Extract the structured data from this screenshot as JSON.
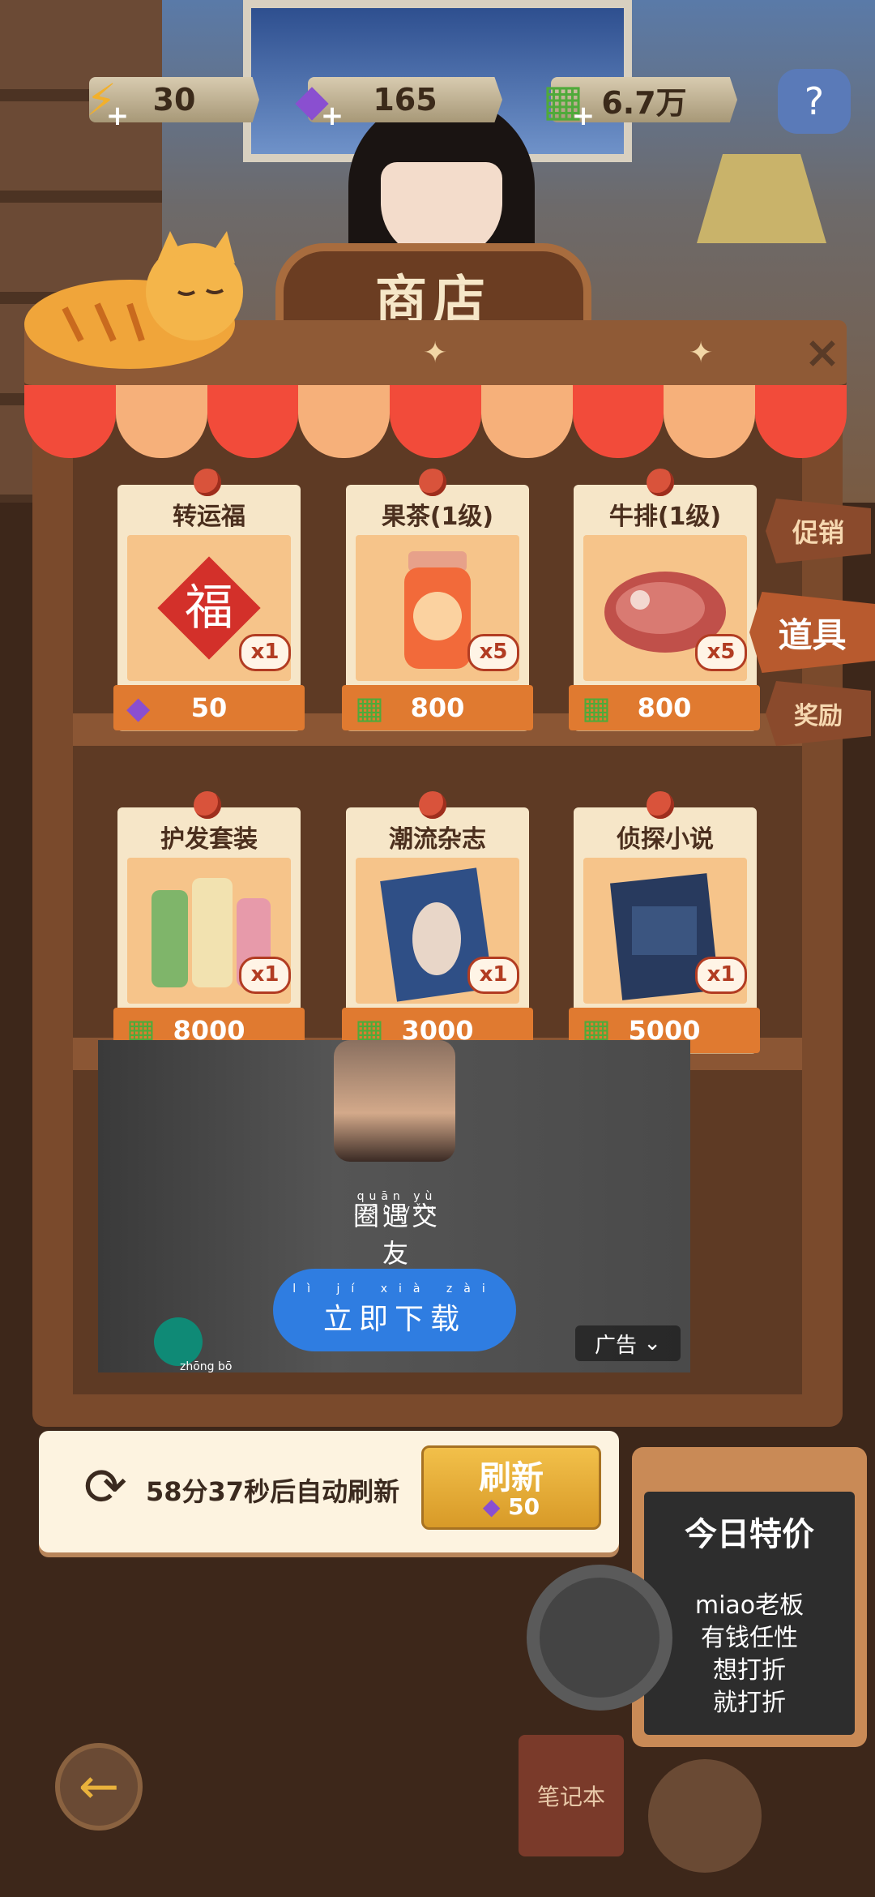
{
  "currencies": {
    "energy": {
      "value": "30",
      "icon": "lightning-icon"
    },
    "gems": {
      "value": "165",
      "icon": "gem-icon"
    },
    "cash": {
      "value": "6.7万",
      "icon": "cash-icon"
    }
  },
  "shop": {
    "title": "商店",
    "close_label": "×"
  },
  "items": [
    {
      "name": "转运福",
      "qty": "x1",
      "price": "50",
      "currency": "gem-icon",
      "icon": "fu-charm-icon"
    },
    {
      "name": "果茶(1级)",
      "qty": "x5",
      "price": "800",
      "currency": "cash-icon",
      "icon": "fruit-tea-icon"
    },
    {
      "name": "牛排(1级)",
      "qty": "x5",
      "price": "800",
      "currency": "cash-icon",
      "icon": "steak-icon"
    },
    {
      "name": "护发套装",
      "qty": "x1",
      "price": "8000",
      "currency": "cash-icon",
      "icon": "hair-care-set-icon"
    },
    {
      "name": "潮流杂志",
      "qty": "x1",
      "price": "3000",
      "currency": "cash-icon",
      "icon": "magazine-icon"
    },
    {
      "name": "侦探小说",
      "qty": "x1",
      "price": "5000",
      "currency": "cash-icon",
      "icon": "detective-novel-icon"
    }
  ],
  "side_tabs": [
    "促销",
    "道具",
    "奖励"
  ],
  "ad": {
    "name": "圈遇交友",
    "name_pinyin": "quān yù jiāo yǒu",
    "button": "立即下载",
    "button_pinyin": "lì jí xià zài",
    "tag": "广告",
    "partial_text_pinyin": "zhōng bō"
  },
  "refresh": {
    "text": "58分37秒后自动刷新",
    "button_label": "刷新",
    "button_price": "50"
  },
  "chalkboard": {
    "title": "今日特价",
    "lines": [
      "miao老板",
      "有钱任性",
      "想打折",
      "就打折"
    ]
  },
  "bottom_nav": {
    "back_icon": "arrow-left-icon",
    "notebook_label": "笔记本"
  },
  "colors": {
    "accent_orange": "#e07a30",
    "wood": "#7a4a2c",
    "ad_button": "#2f7de1",
    "refresh_gold": "#f2c04a"
  }
}
